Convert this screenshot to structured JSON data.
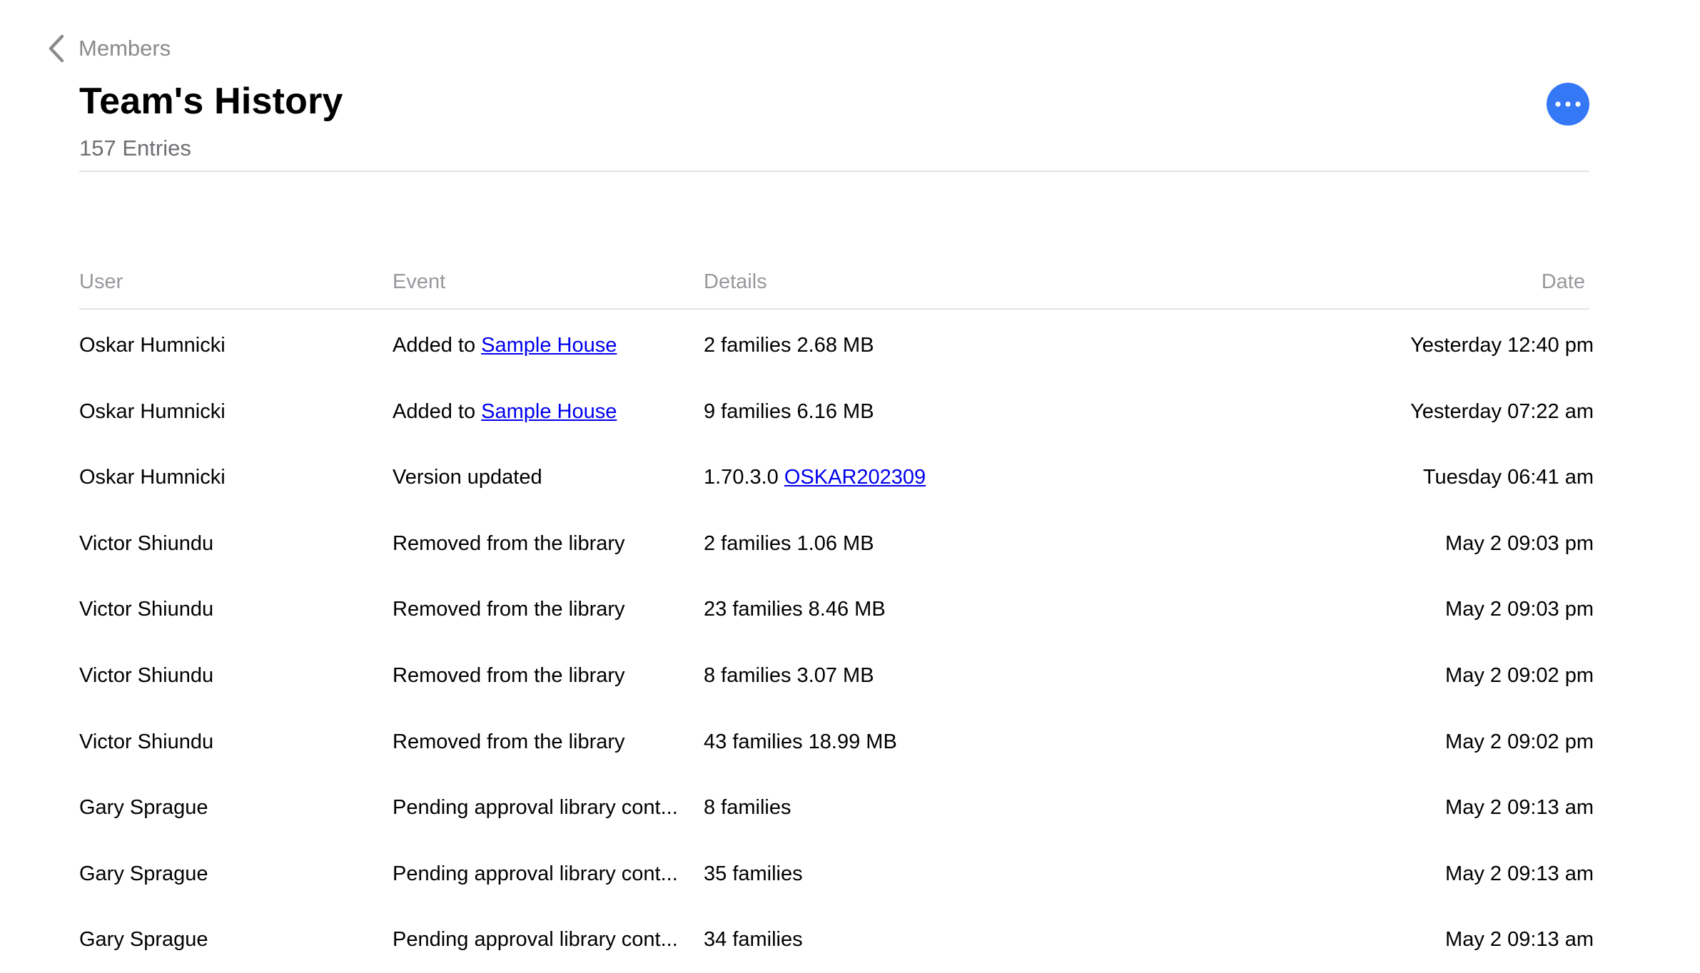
{
  "nav": {
    "back_label": "Members"
  },
  "header": {
    "title": "Team's History",
    "entry_count": "157 Entries",
    "more_button_color": "#3478f6"
  },
  "table": {
    "columns": {
      "user": "User",
      "event": "Event",
      "details": "Details",
      "date": "Date"
    },
    "rows": [
      {
        "user": "Oskar Humnicki",
        "event_text": "Added to ",
        "event_link": "Sample House",
        "details_text": "2 families 2.68 MB",
        "details_link": "",
        "date": "Yesterday 12:40 pm"
      },
      {
        "user": "Oskar Humnicki",
        "event_text": "Added to ",
        "event_link": "Sample House",
        "details_text": "9 families 6.16 MB",
        "details_link": "",
        "date": "Yesterday 07:22 am"
      },
      {
        "user": "Oskar Humnicki",
        "event_text": "Version updated",
        "event_link": "",
        "details_text": "1.70.3.0 ",
        "details_link": "OSKAR202309",
        "date": "Tuesday 06:41 am"
      },
      {
        "user": "Victor Shiundu",
        "event_text": "Removed from the library",
        "event_link": "",
        "details_text": "2 families 1.06 MB",
        "details_link": "",
        "date": "May 2 09:03 pm"
      },
      {
        "user": "Victor Shiundu",
        "event_text": "Removed from the library",
        "event_link": "",
        "details_text": "23 families 8.46 MB",
        "details_link": "",
        "date": "May 2 09:03 pm"
      },
      {
        "user": "Victor Shiundu",
        "event_text": "Removed from the library",
        "event_link": "",
        "details_text": "8 families 3.07 MB",
        "details_link": "",
        "date": "May 2 09:02 pm"
      },
      {
        "user": "Victor Shiundu",
        "event_text": "Removed from the library",
        "event_link": "",
        "details_text": "43 families 18.99 MB",
        "details_link": "",
        "date": "May 2 09:02 pm"
      },
      {
        "user": "Gary Sprague",
        "event_text": "Pending approval library cont...",
        "event_link": "",
        "details_text": "8 families",
        "details_link": "",
        "date": "May 2 09:13 am"
      },
      {
        "user": "Gary Sprague",
        "event_text": "Pending approval library cont...",
        "event_link": "",
        "details_text": "35 families",
        "details_link": "",
        "date": "May 2 09:13 am"
      },
      {
        "user": "Gary Sprague",
        "event_text": "Pending approval library cont...",
        "event_link": "",
        "details_text": "34 families",
        "details_link": "",
        "date": "May 2 09:13 am"
      }
    ]
  },
  "colors": {
    "link": "#0000ee",
    "muted": "#8a8a8e",
    "accent": "#3478f6",
    "divider": "#e3e3e6"
  },
  "icons": {
    "back": "chevron-left-icon",
    "more": "ellipsis-icon"
  }
}
